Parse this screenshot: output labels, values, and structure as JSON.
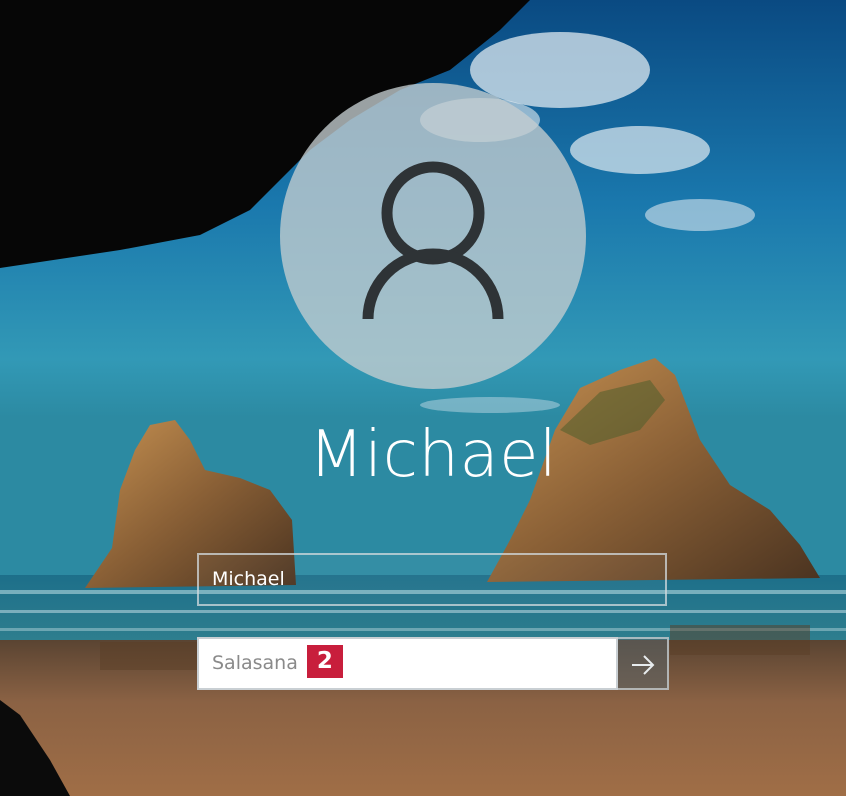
{
  "user": {
    "display_name": "Michael",
    "avatar_icon": "user-silhouette-icon"
  },
  "login": {
    "username_value": "Michael",
    "password_placeholder": "Salasana",
    "step_badge": "2",
    "submit_icon": "arrow-right-icon"
  },
  "colors": {
    "badge": "#c81e3c",
    "text": "#ffffff",
    "placeholder": "#8a8a8a"
  }
}
